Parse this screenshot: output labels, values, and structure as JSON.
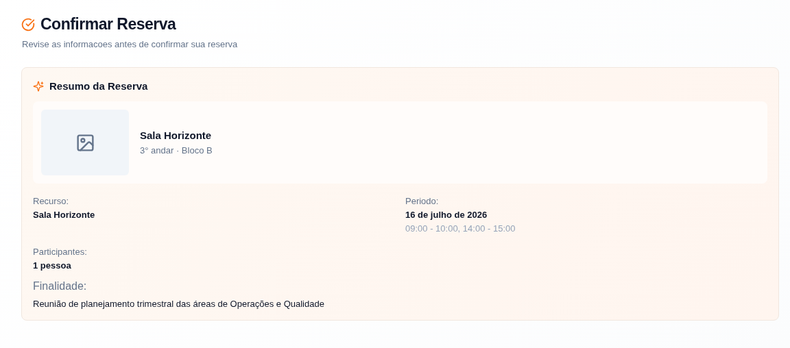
{
  "header": {
    "title": "Confirmar Reserva",
    "subtitle": "Revise as informacoes antes de confirmar sua reserva"
  },
  "summary": {
    "title": "Resumo da Reserva",
    "resource_card": {
      "name": "Sala Horizonte",
      "location": "3° andar · Bloco B"
    },
    "fields": [
      {
        "label": "Recurso:",
        "value": "Sala Horizonte"
      },
      {
        "label": "Periodo:",
        "value": "16 de julho de 2026",
        "detail": "09:00 - 10:00, 14:00 - 15:00"
      },
      {
        "label": "Participantes:",
        "value": "1 pessoa"
      }
    ],
    "purpose": {
      "label": "Finalidade:",
      "text": "Reunião de planejamento trimestral das áreas de Operações e Qualidade"
    }
  }
}
